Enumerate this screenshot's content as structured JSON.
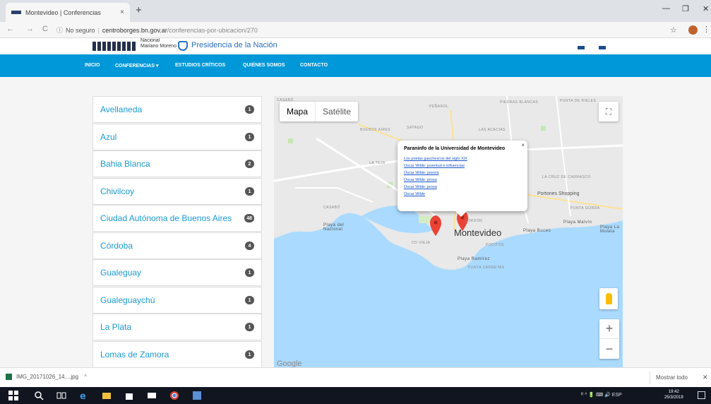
{
  "browser": {
    "tab_title": "Montevideo | Conferencias",
    "tab_close": "×",
    "new_tab": "+",
    "window_controls": [
      "—",
      "❐",
      "✕"
    ],
    "nav": [
      "←",
      "→",
      "C"
    ],
    "security": "No seguro",
    "url_host": "centroborges.bn.gov.ar",
    "url_path": "/conferencias-por-ubicacion/270",
    "bookmark_star": "☆",
    "menu_dots": "⋮"
  },
  "site_header": {
    "logo_small_lines": [
      "Nacional",
      "Mariano Moreno"
    ],
    "presidencia": "Presidencia de la Nación"
  },
  "nav": {
    "items": [
      "INICIO",
      "CONFERENCIAS ▾",
      "ESTUDIOS CRÍTICOS",
      "QUIÉNES SOMOS",
      "CONTACTO"
    ]
  },
  "cities": [
    {
      "name": "Avellaneda",
      "count": "1"
    },
    {
      "name": "Azul",
      "count": "1"
    },
    {
      "name": "Bahia Blanca",
      "count": "2"
    },
    {
      "name": "Chivilcoy",
      "count": "1"
    },
    {
      "name": "Ciudad Autónoma de Buenos Aires",
      "count": "48"
    },
    {
      "name": "Córdoba",
      "count": "4"
    },
    {
      "name": "Gualeguay",
      "count": "1"
    },
    {
      "name": "Gualeguaychú",
      "count": "1"
    },
    {
      "name": "La Plata",
      "count": "1"
    },
    {
      "name": "Lomas de Zamora",
      "count": "1"
    }
  ],
  "map": {
    "toggle_map": "Mapa",
    "toggle_satellite": "Satélite",
    "fullscreen": "⛶",
    "zoom_in": "+",
    "zoom_out": "−",
    "city": "Montevideo",
    "google": "Google",
    "labels": {
      "buceo": "Playa Buceo",
      "malvin": "Playa Malvín",
      "playa_la_mulata": "Playa La Mulata",
      "puntas_carretas": "PUNTA CARRETAS",
      "ramirez": "Playa Ramírez",
      "cerro": "Playa del Nacional",
      "shopping": "Portones Shopping",
      "la_teja": "LA TEJA",
      "casabo": "CASABÓ",
      "cordon": "CORDÓN",
      "pocitos": "POCITOS",
      "ciudad_vieja": "CD VIEJA",
      "las_acacias": "LAS ACACIAS",
      "punta_gorda": "PUNTA GORDA",
      "carrasco": "LA CRUZ DE CARRASCO",
      "buenos_aires": "BUENOS AIRES",
      "penarol": "PEÑAROL",
      "sayago": "SAYAGO",
      "piedras_blancas": "PIEDRAS BLANCAS",
      "punta_rieles": "PUNTA DE RIELES"
    },
    "accent_water": "#aadaff",
    "accent_land": "#e8e8e8",
    "marker_color": "#ea4335"
  },
  "infowindow": {
    "title": "Paraninfo de la Universidad de Montevideo",
    "close": "×",
    "links": [
      "Los poetas gauchescos del siglo XIX",
      "Oscar Wilde: juventud e influencias",
      "Oscar Wilde: poesía",
      "Oscar Wilde: prosa",
      "Oscar Wilde: prosa",
      "Oscar Wilde"
    ]
  },
  "downloads": {
    "file": "IMG_20171026_14....jpg",
    "chevron": "^",
    "show_all": "Mostrar todo",
    "close": "✕"
  },
  "taskbar": {
    "tray": "ᴿ ^ 🔋 ⌨ 🔊 ESP",
    "time": "19:42",
    "date": "25/3/2019"
  }
}
